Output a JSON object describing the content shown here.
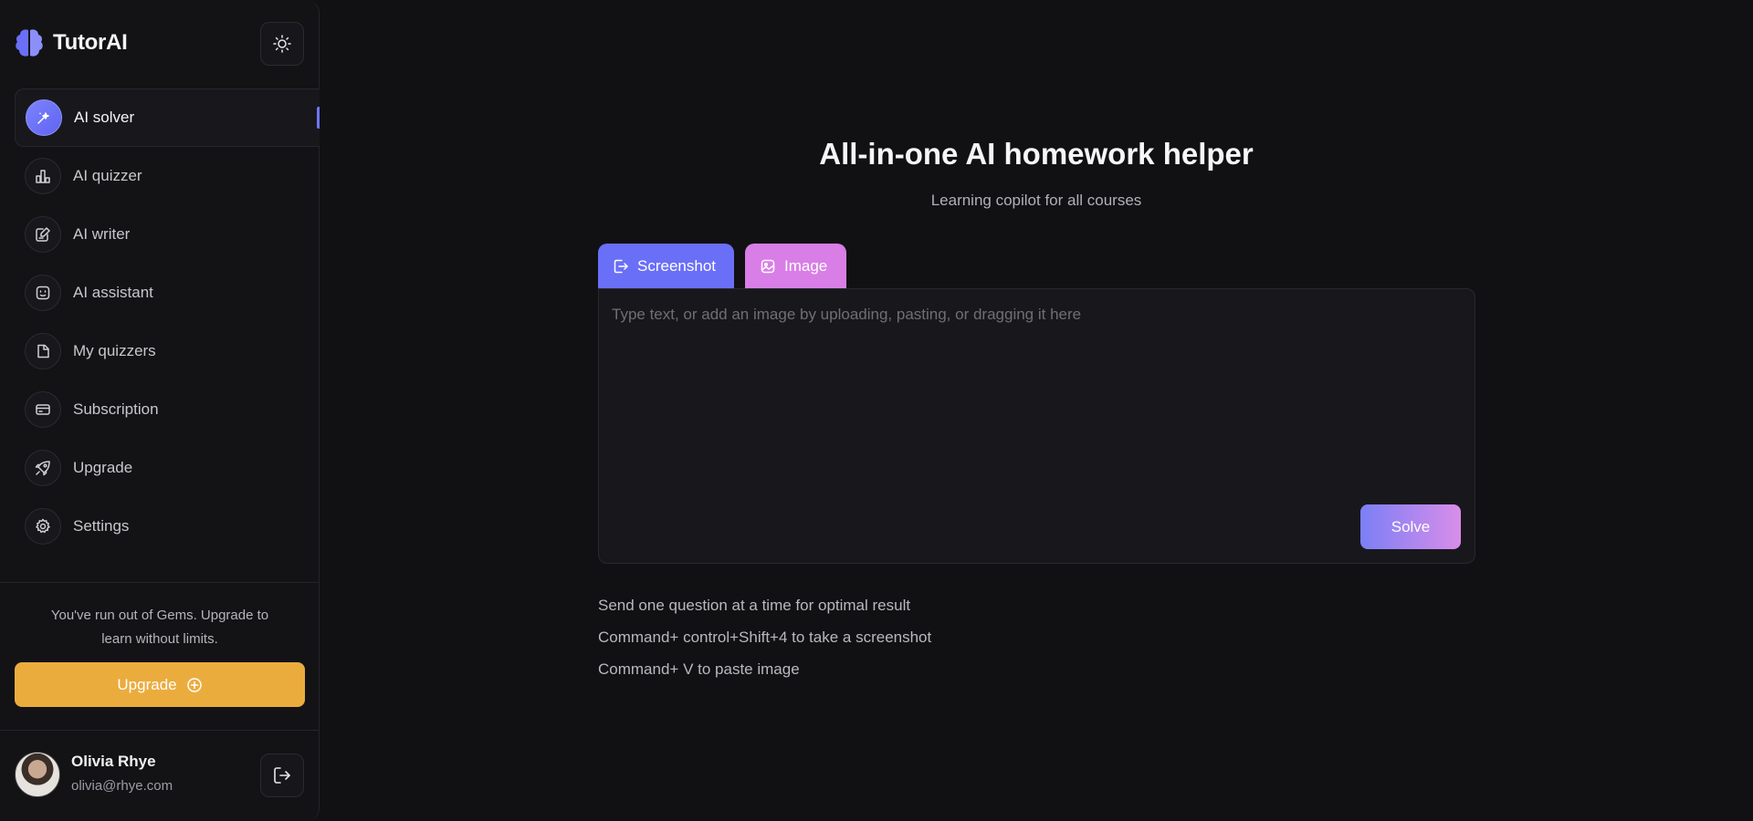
{
  "app": {
    "name": "TutorAI"
  },
  "sidebar": {
    "items": [
      {
        "label": "AI solver",
        "icon": "magic-wand-icon",
        "active": true
      },
      {
        "label": "AI quizzer",
        "icon": "bar-chart-icon",
        "active": false
      },
      {
        "label": "AI writer",
        "icon": "edit-note-icon",
        "active": false
      },
      {
        "label": "AI assistant",
        "icon": "robot-face-icon",
        "active": false
      },
      {
        "label": "My quizzers",
        "icon": "document-icon",
        "active": false
      },
      {
        "label": "Subscription",
        "icon": "credit-card-icon",
        "active": false
      },
      {
        "label": "Upgrade",
        "icon": "rocket-icon",
        "active": false
      },
      {
        "label": "Settings",
        "icon": "gear-icon",
        "active": false
      }
    ],
    "gems_message": "You've run out of Gems. Upgrade to learn without limits.",
    "upgrade_label": "Upgrade"
  },
  "user": {
    "name": "Olivia Rhye",
    "email": "olivia@rhye.com"
  },
  "main": {
    "title": "All-in-one AI homework helper",
    "subtitle": "Learning copilot for all courses",
    "tabs": [
      {
        "label": "Screenshot",
        "icon": "screenshot-icon"
      },
      {
        "label": "Image",
        "icon": "image-icon"
      }
    ],
    "input": {
      "value": "",
      "placeholder": "Type text, or add an image by uploading, pasting, or dragging it here"
    },
    "solve_label": "Solve",
    "tips": [
      "Send one question at a time for optimal result",
      "Command+ control+Shift+4 to take a screenshot",
      "Command+ V to paste image"
    ]
  },
  "colors": {
    "background": "#111114",
    "accent": "#6a6ff7",
    "accent_pink": "#d87ee6",
    "upgrade": "#ebac3e"
  }
}
